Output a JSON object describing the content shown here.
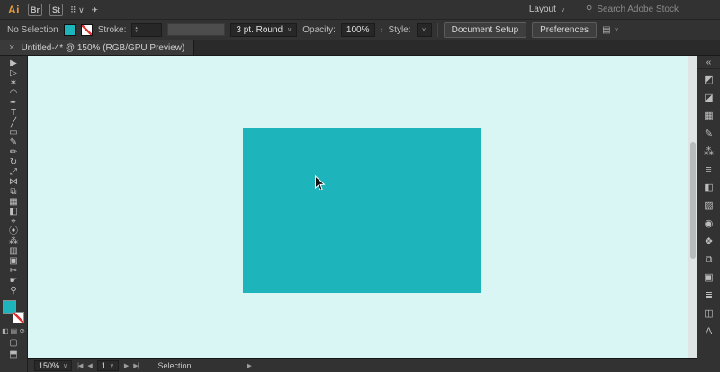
{
  "colors": {
    "accent_teal": "#1db5bb",
    "canvas_bg": "#d9f5f4",
    "ui_dark": "#323232",
    "brand_orange": "#e89b3c",
    "stroke_none_red": "#e23131"
  },
  "menubar": {
    "logo": "Ai",
    "app_icons": [
      {
        "name": "bridge-icon",
        "glyph": "Br"
      },
      {
        "name": "stock-icon",
        "glyph": "St"
      },
      {
        "name": "apps-grid-icon",
        "glyph": "⠿ ∨"
      },
      {
        "name": "share-icon",
        "glyph": "✈"
      }
    ],
    "workspace": {
      "label": "Layout",
      "chevron": "∨"
    },
    "search": {
      "icon": "⚲",
      "placeholder": "Search Adobe Stock"
    }
  },
  "controlbar": {
    "selection_label": "No Selection",
    "stroke_label": "Stroke:",
    "stroke_stepper_up": "▴",
    "stroke_stepper_down": "▾",
    "brush_dropdown": {
      "value": "3 pt. Round",
      "chevron": "∨"
    },
    "opacity_label": "Opacity:",
    "opacity_value": "100%",
    "opacity_link_chevron": "›",
    "style_label": "Style:",
    "style_chevron": "∨",
    "document_setup_button": "Document Setup",
    "preferences_button": "Preferences",
    "panel_menu": {
      "glyph": "▤",
      "chevron": "∨"
    }
  },
  "tabbar": {
    "close": "×",
    "title": "Untitled-4* @ 150% (RGB/GPU Preview)"
  },
  "toolbar": {
    "tools": [
      {
        "name": "selection-tool-icon",
        "glyph": "▶"
      },
      {
        "name": "direct-selection-tool-icon",
        "glyph": "▷"
      },
      {
        "name": "magic-wand-tool-icon",
        "glyph": "✶"
      },
      {
        "name": "lasso-tool-icon",
        "glyph": "◠"
      },
      {
        "name": "pen-tool-icon",
        "glyph": "✒"
      },
      {
        "name": "type-tool-icon",
        "glyph": "T"
      },
      {
        "name": "line-segment-tool-icon",
        "glyph": "╱"
      },
      {
        "name": "rectangle-tool-icon",
        "glyph": "▭"
      },
      {
        "name": "paintbrush-tool-icon",
        "glyph": "✎"
      },
      {
        "name": "pencil-tool-icon",
        "glyph": "✏"
      },
      {
        "name": "rotate-tool-icon",
        "glyph": "↻"
      },
      {
        "name": "scale-tool-icon",
        "glyph": "⤢"
      },
      {
        "name": "width-tool-icon",
        "glyph": "⋈"
      },
      {
        "name": "shape-builder-tool-icon",
        "glyph": "⧉"
      },
      {
        "name": "mesh-tool-icon",
        "glyph": "▦"
      },
      {
        "name": "gradient-tool-icon",
        "glyph": "◧"
      },
      {
        "name": "eyedropper-tool-icon",
        "glyph": "⌖"
      },
      {
        "name": "blend-tool-icon",
        "glyph": "⦿"
      },
      {
        "name": "symbol-sprayer-tool-icon",
        "glyph": "⁂"
      },
      {
        "name": "column-graph-tool-icon",
        "glyph": "▥"
      },
      {
        "name": "artboard-tool-icon",
        "glyph": "▣"
      },
      {
        "name": "slice-tool-icon",
        "glyph": "✂"
      },
      {
        "name": "hand-tool-icon",
        "glyph": "☛"
      },
      {
        "name": "zoom-tool-icon",
        "glyph": "⚲"
      }
    ],
    "modes": [
      {
        "name": "color-mode-icon",
        "glyph": "◧"
      },
      {
        "name": "gradient-mode-icon",
        "glyph": "▤"
      },
      {
        "name": "none-mode-icon",
        "glyph": "⊘"
      }
    ],
    "draw_mode_icon": "▢",
    "screen_mode_icon": "⬒"
  },
  "statusbar": {
    "zoom": {
      "value": "150%",
      "chevron": "∨"
    },
    "nav": {
      "first": "|◀",
      "prev": "◀",
      "artboard": "1",
      "chevron": "∨",
      "next": "▶",
      "last": "▶|"
    },
    "status_label": "Selection",
    "status_menu_arrow": "▶"
  },
  "dock": {
    "collapse_icon": "«",
    "panels": [
      {
        "name": "panel-color-icon",
        "glyph": "◩"
      },
      {
        "name": "panel-color-guide-icon",
        "glyph": "◪"
      },
      {
        "name": "panel-swatches-icon",
        "glyph": "▦"
      },
      {
        "name": "panel-brushes-icon",
        "glyph": "✎"
      },
      {
        "name": "panel-symbols-icon",
        "glyph": "⁂"
      },
      {
        "name": "panel-stroke-icon",
        "glyph": "≡"
      },
      {
        "name": "panel-gradient-icon",
        "glyph": "◧"
      },
      {
        "name": "panel-transparency-icon",
        "glyph": "▨"
      },
      {
        "name": "panel-appearance-icon",
        "glyph": "◉"
      },
      {
        "name": "panel-graphic-styles-icon",
        "glyph": "❖"
      },
      {
        "name": "panel-layers-icon",
        "glyph": "⧉"
      },
      {
        "name": "panel-artboards-icon",
        "glyph": "▣"
      },
      {
        "name": "panel-align-icon",
        "glyph": "≣"
      },
      {
        "name": "panel-pathfinder-icon",
        "glyph": "◫"
      },
      {
        "name": "panel-type-icon",
        "glyph": "A"
      }
    ]
  }
}
